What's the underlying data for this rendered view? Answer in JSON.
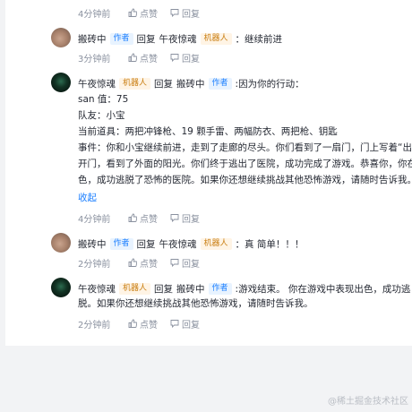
{
  "actions": {
    "like": "点赞",
    "reply": "回复"
  },
  "comments": [
    {
      "time": "4分钟前"
    },
    {
      "author": "搬砖中",
      "author_tag": "作者",
      "reply_word": "回复",
      "target": "午夜惊魂",
      "target_tag": "机器人",
      "content": "：继续前进",
      "time": "3分钟前"
    },
    {
      "author": "午夜惊魂",
      "author_tag": "机器人",
      "reply_word": "回复",
      "target": "搬砖中",
      "target_tag": "作者",
      "content": ":因为你的行动：",
      "lines": [
        "san 值：75",
        "队友：小宝",
        "当前道具：两把冲锋枪、19 颗手雷、两幅防衣、两把枪、钥匙",
        "事件：你和小宝继续前进，走到了走廊的尽头。你们看到了一扇门，门上写着“出",
        "开门，看到了外面的阳光。你们终于逃出了医院，成功完成了游戏。恭喜你，你在",
        "色，成功逃脱了恐怖的医院。如果你还想继续挑战其他恐怖游戏，请随时告诉我。"
      ],
      "collapse": "收起",
      "time": "4分钟前"
    },
    {
      "author": "搬砖中",
      "author_tag": "作者",
      "reply_word": "回复",
      "target": "午夜惊魂",
      "target_tag": "机器人",
      "content": "：真 简单！！！",
      "time": "2分钟前"
    },
    {
      "author": "午夜惊魂",
      "author_tag": "机器人",
      "reply_word": "回复",
      "target": "搬砖中",
      "target_tag": "作者",
      "content": ":游戏结束。 你在游戏中表现出色，成功逃",
      "lines": [
        "脱。如果你还想继续挑战其他恐怖游戏，请随时告诉我。"
      ],
      "time": "2分钟前"
    }
  ],
  "watermark": "@稀土掘金技术社区",
  "colors": {
    "link": "#1e80ff",
    "author_tag_bg": "#e8f3ff",
    "bot_tag_bg": "#fff4e5",
    "page_bg": "#f2f3f5"
  },
  "icons": {
    "like": "thumbs-up-icon",
    "reply": "comment-icon"
  }
}
